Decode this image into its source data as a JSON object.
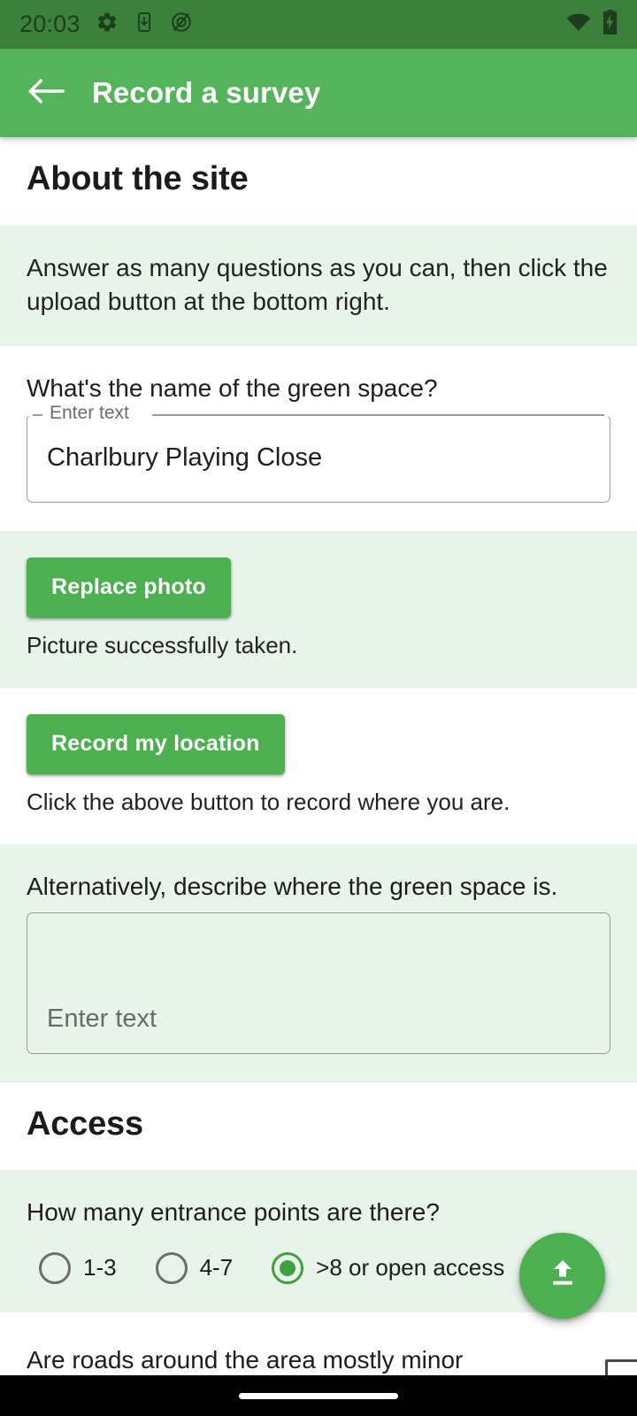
{
  "status_bar": {
    "time": "20:03",
    "icons_left": [
      "gear-icon",
      "phone-download-icon",
      "data-saver-off-icon"
    ],
    "icons_right": [
      "wifi-icon",
      "battery-charging-icon"
    ],
    "background_color": "#3B813B"
  },
  "app_bar": {
    "back_icon": "back-arrow-icon",
    "title": "Record a survey",
    "background_color": "#55B45B",
    "text_color": "#FFFFFF"
  },
  "theme": {
    "accent": "#4CAF50",
    "tint_band": "#E8F4EA",
    "white_band": "#FFFFFF",
    "radio_selected": "#3FA03F"
  },
  "sections": [
    {
      "id": "about-the-site",
      "heading": "About the site"
    },
    {
      "id": "access",
      "heading": "Access"
    }
  ],
  "about": {
    "heading": "About the site",
    "intro": "Answer as many questions as you can, then click the upload button at the bottom right.",
    "name_question": {
      "label": "What's the name of the green space?",
      "field_label": "Enter text",
      "value": "Charlbury Playing Close"
    },
    "photo": {
      "button_label": "Replace photo",
      "status": "Picture successfully taken."
    },
    "location": {
      "button_label": "Record my location",
      "status": "Click the above button to record where you are."
    },
    "describe_question": {
      "label": "Alternatively, describe where the green space is.",
      "placeholder": "Enter text",
      "value": ""
    }
  },
  "access": {
    "heading": "Access",
    "entrances_question": {
      "label": "How many entrance points are there?",
      "options": [
        {
          "label": "1-3",
          "selected": false
        },
        {
          "label": "4-7",
          "selected": false
        },
        {
          "label": ">8 or open access",
          "selected": true
        }
      ]
    },
    "roads_question": {
      "label": "Are roads around the area mostly minor"
    }
  },
  "fab": {
    "icon": "upload-icon",
    "color": "#4CAF50"
  },
  "nav_bar": {
    "gesture_pill": true
  }
}
